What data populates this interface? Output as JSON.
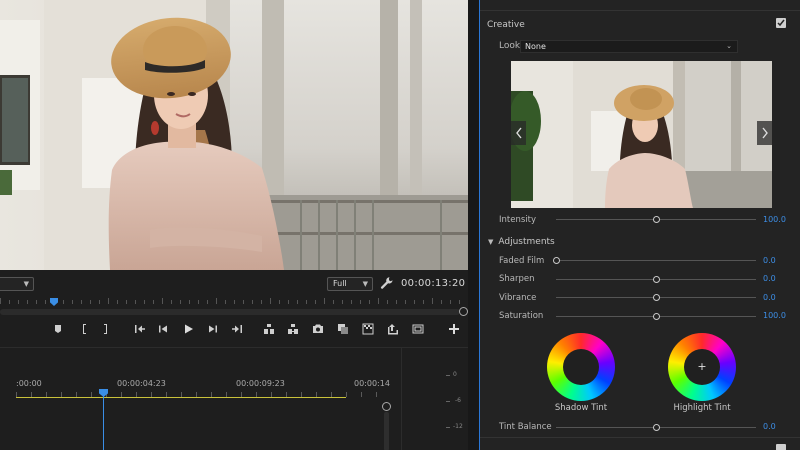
{
  "program_monitor": {
    "zoom_level": "Full",
    "timecode": "00:00:13:20",
    "playhead_fraction": 0.115
  },
  "transport": {
    "icons": [
      "marker-icon",
      "mark-in-icon",
      "mark-out-icon",
      "go-to-in-icon",
      "step-back-icon",
      "play-icon",
      "step-forward-icon",
      "go-to-out-icon",
      "lift-icon",
      "extract-icon",
      "export-frame-icon",
      "comparison-view-icon",
      "proxy-toggle-icon",
      "insert-icon",
      "safe-margins-icon",
      "add-button-icon"
    ]
  },
  "timeline": {
    "timecodes": [
      ":00:00",
      "00:00:04:23",
      "00:00:09:23",
      "00:00:14"
    ],
    "meter_labels": [
      "0",
      "-6",
      "-12"
    ]
  },
  "lumetri": {
    "creative": {
      "title": "Creative",
      "enabled": true,
      "look_label": "Look",
      "look_value": "None",
      "intensity_label": "Intensity",
      "intensity_value": "100.0",
      "intensity_level": 0.5
    },
    "adjustments": {
      "title": "Adjustments",
      "rows": [
        {
          "label": "Faded Film",
          "value": "0.0",
          "level": 0.0
        },
        {
          "label": "Sharpen",
          "value": "0.0",
          "level": 0.5
        },
        {
          "label": "Vibrance",
          "value": "0.0",
          "level": 0.5
        },
        {
          "label": "Saturation",
          "value": "100.0",
          "level": 0.5
        }
      ],
      "shadow_tint_label": "Shadow Tint",
      "highlight_tint_label": "Highlight Tint",
      "tint_balance_label": "Tint Balance",
      "tint_balance_value": "0.0",
      "tint_balance_level": 0.5
    }
  },
  "colors": {
    "accent": "#3d8ee6",
    "work_area": "#c9c23a"
  }
}
